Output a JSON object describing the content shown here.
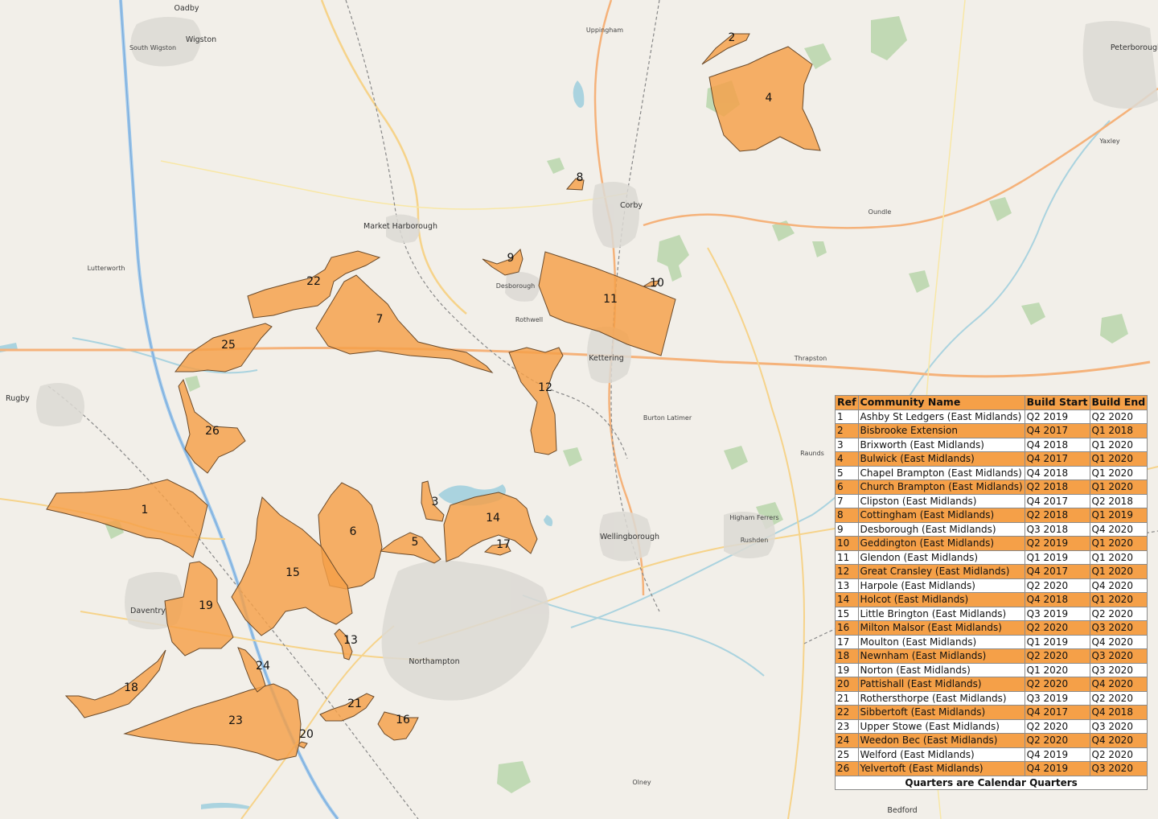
{
  "towns": [
    {
      "name": "Oadby"
    },
    {
      "name": "South Wigston"
    },
    {
      "name": "Wigston"
    },
    {
      "name": "Uppingham"
    },
    {
      "name": "Market Harborough"
    },
    {
      "name": "Corby"
    },
    {
      "name": "Desborough"
    },
    {
      "name": "Rothwell"
    },
    {
      "name": "Kettering"
    },
    {
      "name": "Lutterworth"
    },
    {
      "name": "Rugby"
    },
    {
      "name": "Daventry"
    },
    {
      "name": "Northampton"
    },
    {
      "name": "Wellingborough"
    },
    {
      "name": "Rushden"
    },
    {
      "name": "Thrapston"
    },
    {
      "name": "Oundle"
    },
    {
      "name": "Peterborough"
    },
    {
      "name": "Yaxley"
    },
    {
      "name": "Olney"
    },
    {
      "name": "Bedford"
    },
    {
      "name": "Burton Latimer"
    },
    {
      "name": "Higham Ferrers"
    },
    {
      "name": "Raunds"
    }
  ],
  "areas": [
    {
      "ref": "1",
      "label": "1"
    },
    {
      "ref": "2",
      "label": "2"
    },
    {
      "ref": "3",
      "label": "3"
    },
    {
      "ref": "4",
      "label": "4"
    },
    {
      "ref": "5",
      "label": "5"
    },
    {
      "ref": "6",
      "label": "6"
    },
    {
      "ref": "7",
      "label": "7"
    },
    {
      "ref": "8",
      "label": "8"
    },
    {
      "ref": "9",
      "label": "9"
    },
    {
      "ref": "10",
      "label": "10"
    },
    {
      "ref": "11",
      "label": "11"
    },
    {
      "ref": "12",
      "label": "12"
    },
    {
      "ref": "13",
      "label": "13"
    },
    {
      "ref": "14",
      "label": "14"
    },
    {
      "ref": "15",
      "label": "15"
    },
    {
      "ref": "16",
      "label": "16"
    },
    {
      "ref": "17",
      "label": "17"
    },
    {
      "ref": "18",
      "label": "18"
    },
    {
      "ref": "19",
      "label": "19"
    },
    {
      "ref": "20",
      "label": "20"
    },
    {
      "ref": "21",
      "label": "21"
    },
    {
      "ref": "22",
      "label": "22"
    },
    {
      "ref": "23",
      "label": "23"
    },
    {
      "ref": "24",
      "label": "24"
    },
    {
      "ref": "25",
      "label": "25"
    },
    {
      "ref": "26",
      "label": "26"
    }
  ],
  "legend": {
    "headers": {
      "ref": "Ref",
      "name": "Community Name",
      "start": "Build Start",
      "end": "Build End"
    },
    "rows": [
      {
        "ref": "1",
        "name": "Ashby St Ledgers (East Midlands)",
        "start": "Q2 2019",
        "end": "Q2 2020"
      },
      {
        "ref": "2",
        "name": "Bisbrooke Extension",
        "start": "Q4 2017",
        "end": "Q1 2018"
      },
      {
        "ref": "3",
        "name": "Brixworth (East Midlands)",
        "start": "Q4 2018",
        "end": "Q1 2020"
      },
      {
        "ref": "4",
        "name": "Bulwick (East Midlands)",
        "start": "Q4 2017",
        "end": "Q1 2020"
      },
      {
        "ref": "5",
        "name": "Chapel Brampton (East Midlands)",
        "start": "Q4 2018",
        "end": "Q1 2020"
      },
      {
        "ref": "6",
        "name": "Church Brampton (East Midlands)",
        "start": "Q2 2018",
        "end": "Q1 2020"
      },
      {
        "ref": "7",
        "name": "Clipston (East Midlands)",
        "start": "Q4 2017",
        "end": "Q2 2018"
      },
      {
        "ref": "8",
        "name": "Cottingham (East Midlands)",
        "start": "Q2 2018",
        "end": "Q1 2019"
      },
      {
        "ref": "9",
        "name": "Desborough (East Midlands)",
        "start": "Q3 2018",
        "end": "Q4 2020"
      },
      {
        "ref": "10",
        "name": "Geddington (East Midlands)",
        "start": "Q2 2019",
        "end": "Q1 2020"
      },
      {
        "ref": "11",
        "name": "Glendon (East Midlands)",
        "start": "Q1 2019",
        "end": "Q1 2020"
      },
      {
        "ref": "12",
        "name": "Great Cransley (East Midlands)",
        "start": "Q4 2017",
        "end": "Q1 2020"
      },
      {
        "ref": "13",
        "name": "Harpole (East Midlands)",
        "start": "Q2 2020",
        "end": "Q4 2020"
      },
      {
        "ref": "14",
        "name": "Holcot (East Midlands)",
        "start": "Q4 2018",
        "end": "Q1 2020"
      },
      {
        "ref": "15",
        "name": "Little Brington (East Midlands)",
        "start": "Q3 2019",
        "end": "Q2 2020"
      },
      {
        "ref": "16",
        "name": "Milton Malsor (East Midlands)",
        "start": "Q2 2020",
        "end": "Q3 2020"
      },
      {
        "ref": "17",
        "name": "Moulton (East Midlands)",
        "start": "Q1 2019",
        "end": "Q4 2020"
      },
      {
        "ref": "18",
        "name": "Newnham (East Midlands)",
        "start": "Q2 2020",
        "end": "Q3 2020"
      },
      {
        "ref": "19",
        "name": "Norton (East Midlands)",
        "start": "Q1 2020",
        "end": "Q3 2020"
      },
      {
        "ref": "20",
        "name": "Pattishall (East Midlands)",
        "start": "Q2 2020",
        "end": "Q4 2020"
      },
      {
        "ref": "21",
        "name": "Rothersthorpe (East Midlands)",
        "start": "Q3 2019",
        "end": "Q2 2020"
      },
      {
        "ref": "22",
        "name": "Sibbertoft (East Midlands)",
        "start": "Q4 2017",
        "end": "Q4 2018"
      },
      {
        "ref": "23",
        "name": "Upper Stowe (East Midlands)",
        "start": "Q2 2020",
        "end": "Q3 2020"
      },
      {
        "ref": "24",
        "name": "Weedon Bec (East Midlands)",
        "start": "Q2 2020",
        "end": "Q4 2020"
      },
      {
        "ref": "25",
        "name": "Welford (East Midlands)",
        "start": "Q4 2019",
        "end": "Q2 2020"
      },
      {
        "ref": "26",
        "name": "Yelvertoft (East Midlands)",
        "start": "Q4 2019",
        "end": "Q3 2020"
      }
    ],
    "footer": "Quarters are Calendar Quarters"
  },
  "colors": {
    "area_fill": "#f5a048",
    "map_background": "#f2efe9",
    "water": "#aad3df",
    "woodland": "#add19e"
  }
}
